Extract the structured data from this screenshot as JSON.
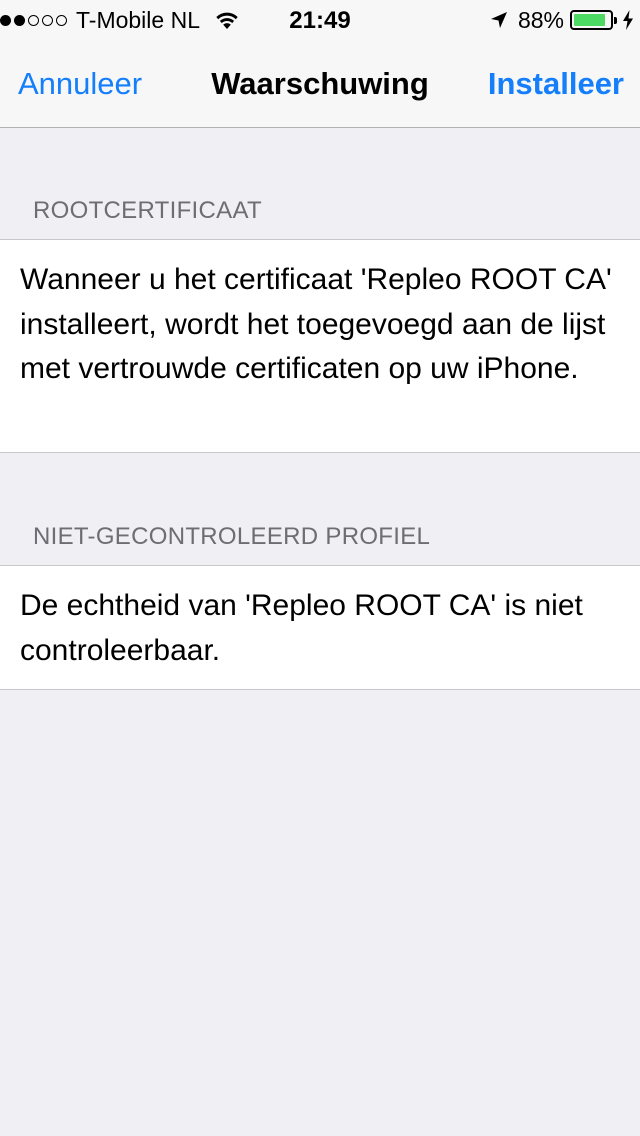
{
  "status_bar": {
    "carrier": "T-Mobile NL",
    "time": "21:49",
    "battery_percent": "88%",
    "battery_level": 0.88,
    "signal_bars_filled": 2,
    "signal_bars_total": 5,
    "icons": [
      "signal-dots-icon",
      "wifi-icon",
      "location-arrow-icon",
      "battery-icon",
      "charging-bolt-icon"
    ]
  },
  "nav": {
    "cancel_label": "Annuleer",
    "title": "Waarschuwing",
    "install_label": "Installeer"
  },
  "sections": [
    {
      "header": "ROOTCERTIFICAAT",
      "text": "Wanneer u het certificaat 'Repleo ROOT CA' installeert, wordt het toegevoegd aan de lijst met vertrouwde certificaten op uw iPhone."
    },
    {
      "header": "NIET-GECONTROLEERD PROFIEL",
      "text": "De echtheid van 'Repleo ROOT CA' is niet controleerbaar."
    }
  ],
  "colors": {
    "accent": "#157efb",
    "background": "#efeff4",
    "bar_background": "#f7f7f7",
    "section_header": "#6d6d72",
    "battery_green": "#4cd964"
  }
}
